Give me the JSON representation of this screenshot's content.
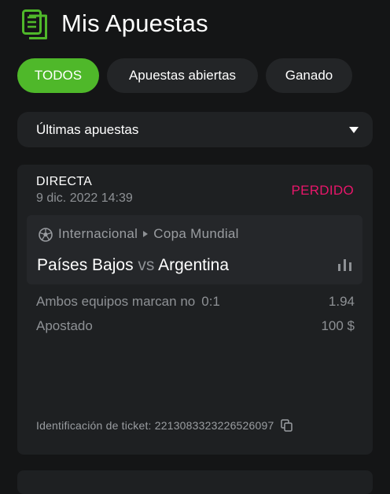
{
  "header": {
    "title": "Mis Apuestas",
    "icon": "document-list-icon"
  },
  "filters": [
    {
      "label": "TODOS",
      "active": true
    },
    {
      "label": "Apuestas abiertas",
      "active": false
    },
    {
      "label": "Ganado",
      "active": false
    }
  ],
  "dropdown": {
    "selected": "Últimas apuestas"
  },
  "bet": {
    "type": "DIRECTA",
    "date": "9 dic. 2022 14:39",
    "status": "PERDIDO",
    "league_country": "Internacional",
    "league_name": "Copa Mundial",
    "home_team": "Países Bajos",
    "vs": "vs",
    "away_team": "Argentina",
    "selection": "Ambos equipos marcan no",
    "selection_score": "0:1",
    "odds": "1.94",
    "stake_label": "Apostado",
    "stake": "100 $",
    "ticket_label": "Identificación de ticket:",
    "ticket_id": "2213083323226526097"
  },
  "colors": {
    "accent": "#4fb82a",
    "status_lost": "#e8166a",
    "background": "#141516",
    "card": "#1e2022"
  }
}
